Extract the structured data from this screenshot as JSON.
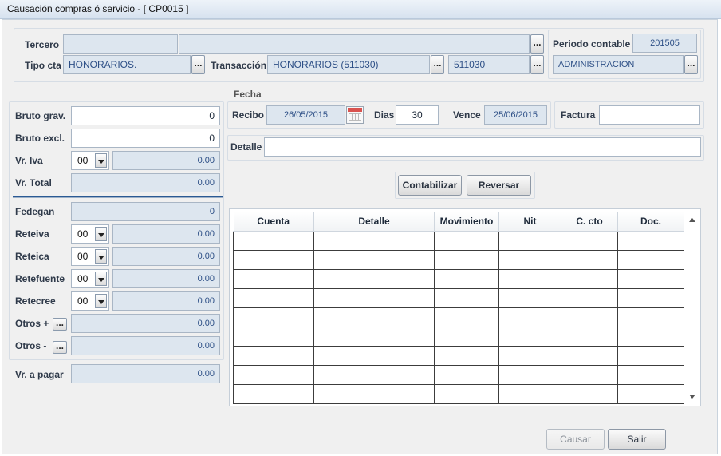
{
  "window": {
    "title": "Causación compras ó servicio - [ CP0015 ]"
  },
  "header": {
    "tercero_label": "Tercero",
    "tercero_code": "",
    "tercero_name": "",
    "tipo_cta_label": "Tipo cta",
    "tipo_cta_value": "HONORARIOS.",
    "transaccion_label": "Transacción",
    "transaccion_value": "HONORARIOS (511030)",
    "cuenta_value": "511030",
    "periodo_label": "Periodo contable",
    "periodo_value": "201505",
    "centro_value": "ADMINISTRACION",
    "ellipsis": "..."
  },
  "fecha": {
    "group_label": "Fecha",
    "recibo_label": "Recibo",
    "recibo_value": "26/05/2015",
    "dias_label": "Dias",
    "dias_value": "30",
    "vence_label": "Vence",
    "vence_value": "25/06/2015",
    "factura_label": "Factura",
    "factura_value": ""
  },
  "detalle": {
    "label": "Detalle",
    "value": ""
  },
  "totals": {
    "bruto_grav_label": "Bruto grav.",
    "bruto_grav_value": "0",
    "bruto_excl_label": "Bruto excl.",
    "bruto_excl_value": "0",
    "vr_iva_label": "Vr. Iva",
    "vr_iva_code": "00",
    "vr_iva_value": "0.00",
    "vr_total_label": "Vr. Total",
    "vr_total_value": "0.00"
  },
  "deductions": {
    "fedegan_label": "Fedegan",
    "fedegan_value": "0",
    "reteiva_label": "Reteiva",
    "reteiva_code": "00",
    "reteiva_value": "0.00",
    "reteica_label": "Reteica",
    "reteica_code": "00",
    "reteica_value": "0.00",
    "retefuente_label": "Retefuente",
    "retefuente_code": "00",
    "retefuente_value": "0.00",
    "retecree_label": "Retecree",
    "retecree_code": "00",
    "retecree_value": "0.00",
    "otros_mas_label": "Otros +",
    "otros_mas_value": "0.00",
    "otros_menos_label": "Otros -",
    "otros_menos_value": "0.00"
  },
  "pagar": {
    "label": "Vr. a pagar",
    "value": "0.00"
  },
  "actions": {
    "contabilizar": "Contabilizar",
    "reversar": "Reversar",
    "causar": "Causar",
    "salir": "Salir"
  },
  "grid": {
    "columns": [
      "Cuenta",
      "Detalle",
      "Movimiento",
      "Nit",
      "C. cto",
      "Doc."
    ]
  },
  "colors": {
    "readonly_bg": "#dde6ef",
    "readonly_text": "#2d4f86",
    "accent": "#2b5a94"
  }
}
